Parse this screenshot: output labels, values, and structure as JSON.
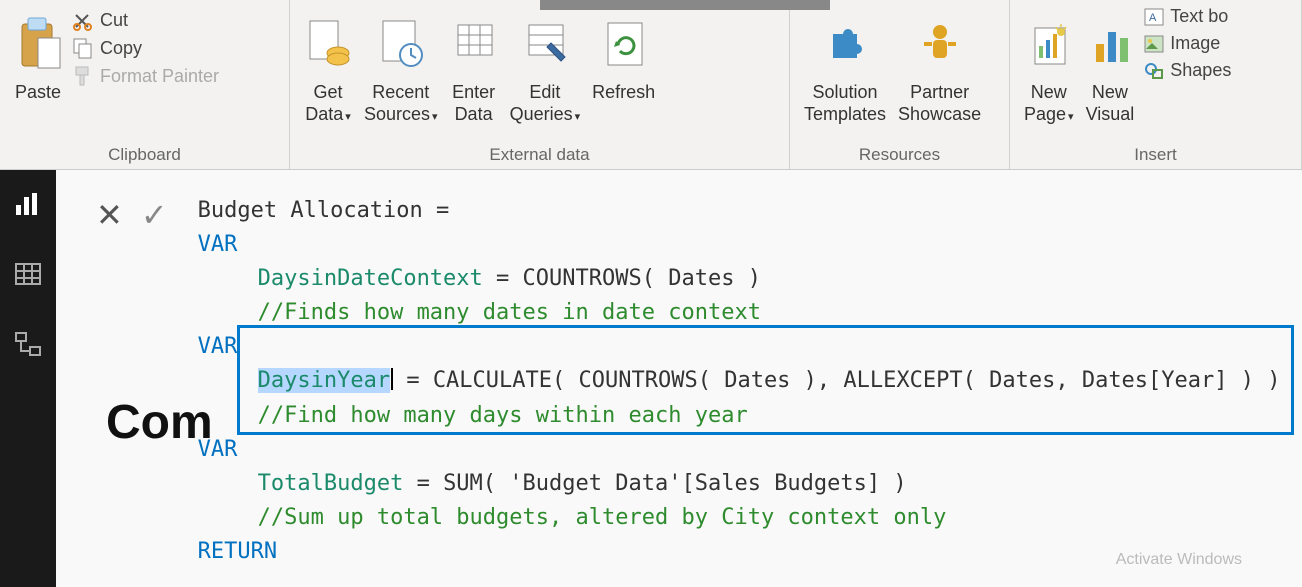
{
  "ribbon": {
    "clipboard": {
      "label": "Clipboard",
      "paste": "Paste",
      "cut": "Cut",
      "copy": "Copy",
      "format_painter": "Format Painter"
    },
    "external_data": {
      "label": "External data",
      "get_data": "Get\nData",
      "recent_sources": "Recent\nSources",
      "enter_data": "Enter\nData",
      "edit_queries": "Edit\nQueries",
      "refresh": "Refresh"
    },
    "resources": {
      "label": "Resources",
      "solution_templates": "Solution\nTemplates",
      "partner_showcase": "Partner\nShowcase"
    },
    "insert": {
      "label": "Insert",
      "new_page": "New\nPage",
      "new_visual": "New\nVisual",
      "text_box": "Text bo",
      "image": "Image",
      "shapes": "Shapes"
    }
  },
  "formula": {
    "line1": "Budget Allocation =",
    "kw_var": "VAR",
    "v1_name": "DaysinDateContext",
    "v1_expr": " = COUNTROWS( Dates )",
    "v1_comment": "//Finds how many dates in date context",
    "v2_name": "DaysinYear",
    "v2_expr": " = CALCULATE( COUNTROWS( Dates ), ALLEXCEPT( Dates, Dates[Year] ) )",
    "v2_comment": "//Find how many days within each year",
    "v3_name": "TotalBudget",
    "v3_expr": " = SUM( 'Budget Data'[Sales Budgets] )",
    "v3_comment": "//Sum up total budgets, altered by City context only",
    "kw_return": "RETURN"
  },
  "report_title": "Com",
  "watermark": "Activate Windows",
  "glyphs": {
    "x": "✕",
    "check": "✓",
    "caret": "▾"
  }
}
